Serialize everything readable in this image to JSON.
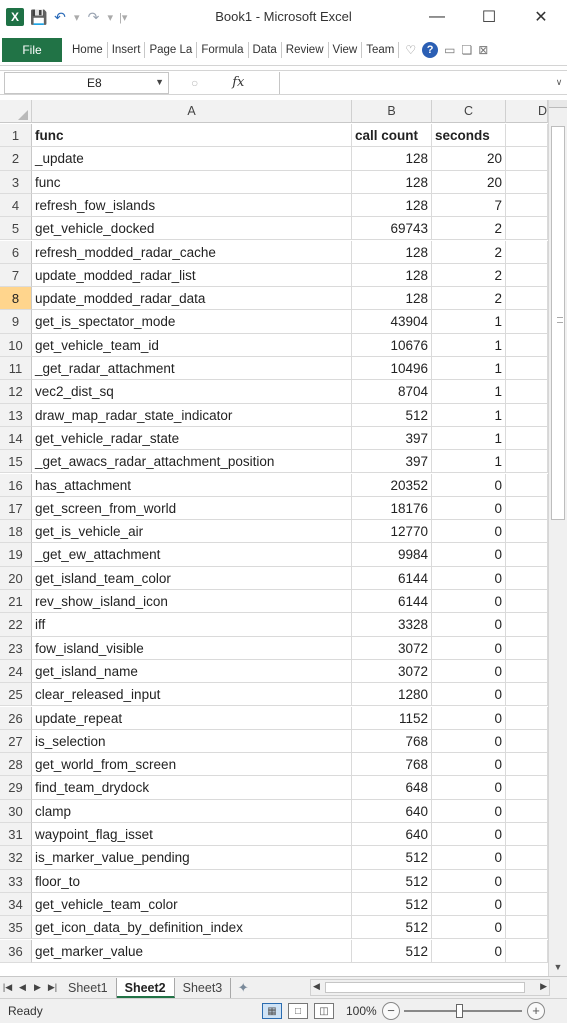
{
  "window": {
    "title": "Book1 - Microsoft Excel",
    "minimize": "—",
    "maximize": "☐",
    "close": "✕"
  },
  "ribbon": {
    "file": "File",
    "tabs": [
      "Home",
      "Insert",
      "Page La",
      "Formula",
      "Data",
      "Review",
      "View",
      "Team"
    ]
  },
  "formula_bar": {
    "name_box": "E8",
    "fx": "fx",
    "value": ""
  },
  "columns": [
    "A",
    "B",
    "C",
    "D"
  ],
  "rows": [
    {
      "n": "1",
      "a": "func",
      "b": "call count",
      "c": "seconds"
    },
    {
      "n": "2",
      "a": "_update",
      "b": "128",
      "c": "20"
    },
    {
      "n": "3",
      "a": "func",
      "b": "128",
      "c": "20"
    },
    {
      "n": "4",
      "a": "refresh_fow_islands",
      "b": "128",
      "c": "7"
    },
    {
      "n": "5",
      "a": "get_vehicle_docked",
      "b": "69743",
      "c": "2"
    },
    {
      "n": "6",
      "a": "refresh_modded_radar_cache",
      "b": "128",
      "c": "2"
    },
    {
      "n": "7",
      "a": "update_modded_radar_list",
      "b": "128",
      "c": "2"
    },
    {
      "n": "8",
      "a": "update_modded_radar_data",
      "b": "128",
      "c": "2"
    },
    {
      "n": "9",
      "a": "get_is_spectator_mode",
      "b": "43904",
      "c": "1"
    },
    {
      "n": "10",
      "a": "get_vehicle_team_id",
      "b": "10676",
      "c": "1"
    },
    {
      "n": "11",
      "a": "_get_radar_attachment",
      "b": "10496",
      "c": "1"
    },
    {
      "n": "12",
      "a": "vec2_dist_sq",
      "b": "8704",
      "c": "1"
    },
    {
      "n": "13",
      "a": "draw_map_radar_state_indicator",
      "b": "512",
      "c": "1"
    },
    {
      "n": "14",
      "a": "get_vehicle_radar_state",
      "b": "397",
      "c": "1"
    },
    {
      "n": "15",
      "a": "_get_awacs_radar_attachment_position",
      "b": "397",
      "c": "1"
    },
    {
      "n": "16",
      "a": "has_attachment",
      "b": "20352",
      "c": "0"
    },
    {
      "n": "17",
      "a": "get_screen_from_world",
      "b": "18176",
      "c": "0"
    },
    {
      "n": "18",
      "a": "get_is_vehicle_air",
      "b": "12770",
      "c": "0"
    },
    {
      "n": "19",
      "a": "_get_ew_attachment",
      "b": "9984",
      "c": "0"
    },
    {
      "n": "20",
      "a": "get_island_team_color",
      "b": "6144",
      "c": "0"
    },
    {
      "n": "21",
      "a": "rev_show_island_icon",
      "b": "6144",
      "c": "0"
    },
    {
      "n": "22",
      "a": "iff",
      "b": "3328",
      "c": "0"
    },
    {
      "n": "23",
      "a": "fow_island_visible",
      "b": "3072",
      "c": "0"
    },
    {
      "n": "24",
      "a": "get_island_name",
      "b": "3072",
      "c": "0"
    },
    {
      "n": "25",
      "a": "clear_released_input",
      "b": "1280",
      "c": "0"
    },
    {
      "n": "26",
      "a": "update_repeat",
      "b": "1152",
      "c": "0"
    },
    {
      "n": "27",
      "a": "is_selection",
      "b": "768",
      "c": "0"
    },
    {
      "n": "28",
      "a": "get_world_from_screen",
      "b": "768",
      "c": "0"
    },
    {
      "n": "29",
      "a": "find_team_drydock",
      "b": "648",
      "c": "0"
    },
    {
      "n": "30",
      "a": "clamp",
      "b": "640",
      "c": "0"
    },
    {
      "n": "31",
      "a": "waypoint_flag_isset",
      "b": "640",
      "c": "0"
    },
    {
      "n": "32",
      "a": "is_marker_value_pending",
      "b": "512",
      "c": "0"
    },
    {
      "n": "33",
      "a": "floor_to",
      "b": "512",
      "c": "0"
    },
    {
      "n": "34",
      "a": "get_vehicle_team_color",
      "b": "512",
      "c": "0"
    },
    {
      "n": "35",
      "a": "get_icon_data_by_definition_index",
      "b": "512",
      "c": "0"
    },
    {
      "n": "36",
      "a": "get_marker_value",
      "b": "512",
      "c": "0"
    }
  ],
  "selected_row": "8",
  "sheets": [
    "Sheet1",
    "Sheet2",
    "Sheet3"
  ],
  "active_sheet": "Sheet2",
  "status": {
    "text": "Ready",
    "zoom": "100%"
  }
}
